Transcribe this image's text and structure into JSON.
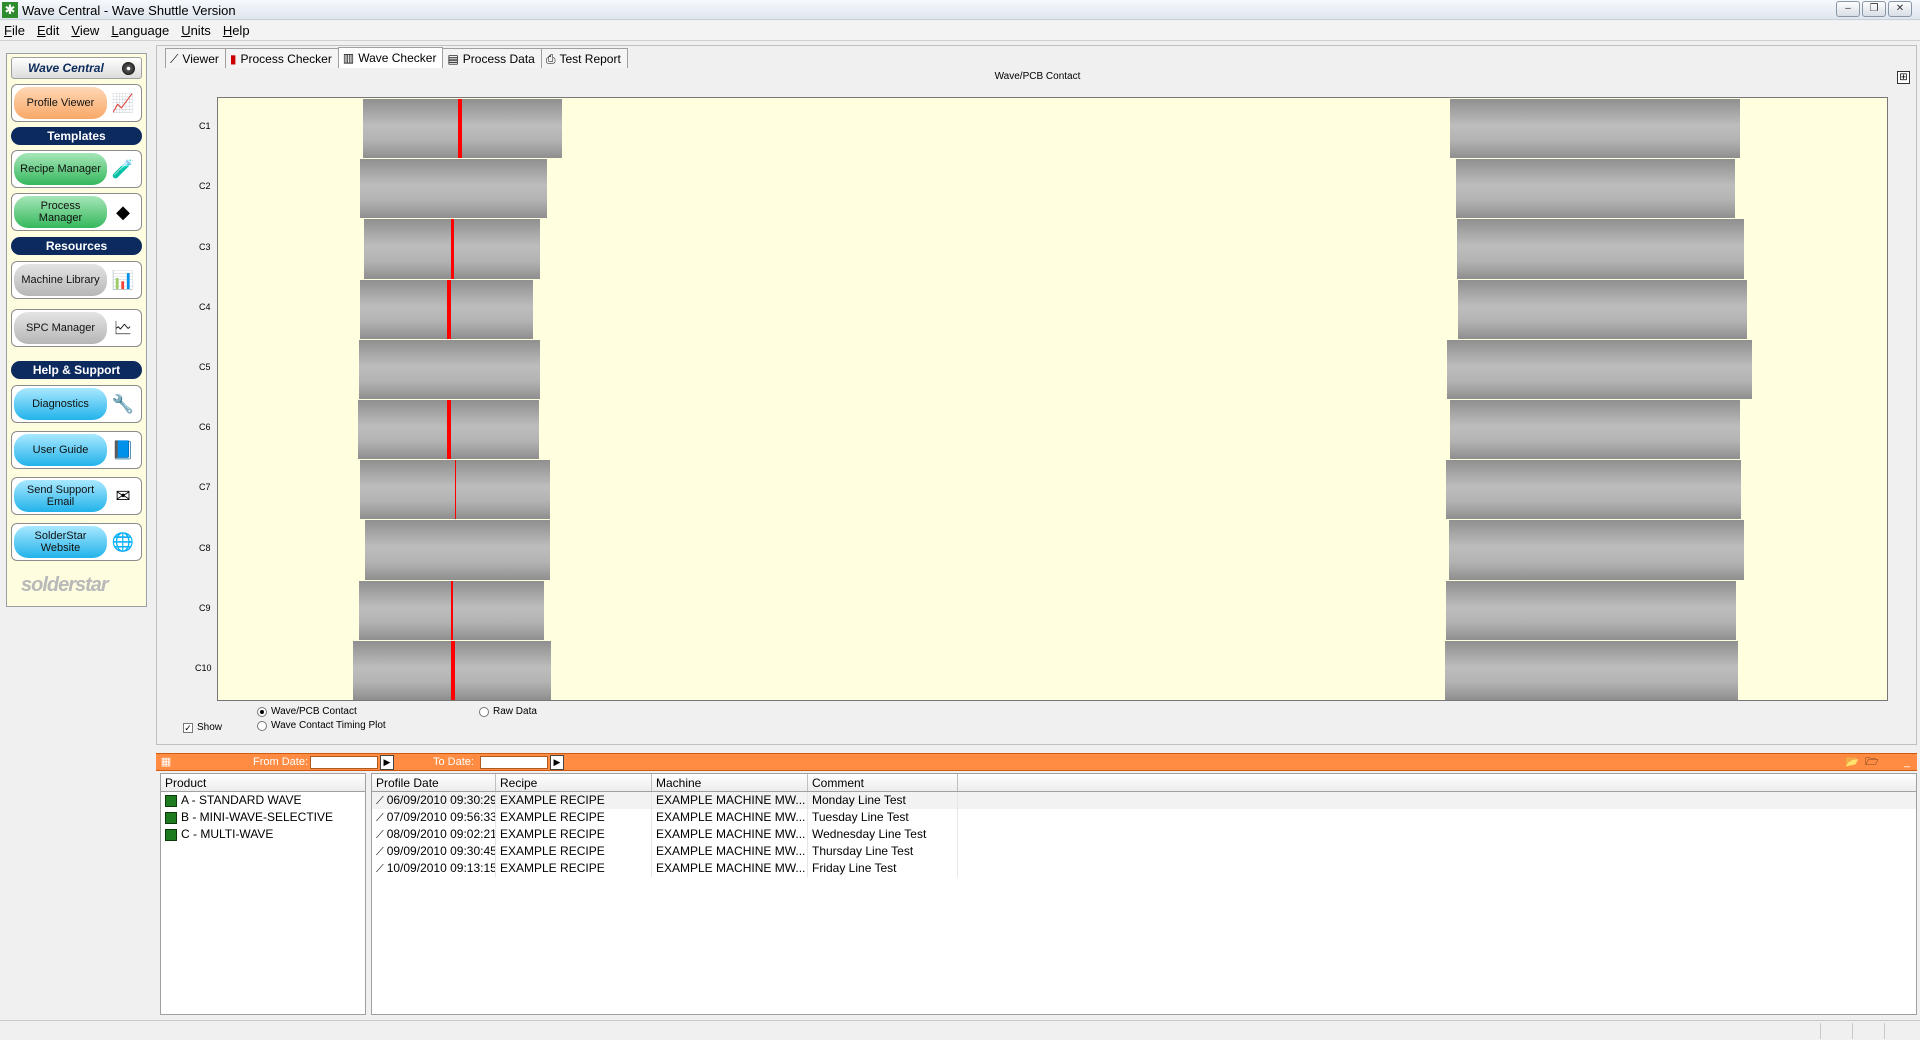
{
  "window": {
    "title": "Wave Central - Wave Shuttle Version",
    "controls": {
      "minimize": "–",
      "restore": "❐",
      "close": "✕"
    }
  },
  "menu": {
    "items": [
      {
        "ul": "F",
        "rest": "ile"
      },
      {
        "ul": "E",
        "rest": "dit"
      },
      {
        "ul": "V",
        "rest": "iew"
      },
      {
        "ul": "L",
        "rest": "anguage"
      },
      {
        "ul": "U",
        "rest": "nits"
      },
      {
        "ul": "H",
        "rest": "elp"
      }
    ]
  },
  "sidebar": {
    "header": "Wave Central",
    "buttons": {
      "profile_viewer": "Profile Viewer",
      "recipe_manager": "Recipe Manager",
      "process_manager": "Process Manager",
      "machine_library": "Machine Library",
      "spc_manager": "SPC Manager",
      "diagnostics": "Diagnostics",
      "user_guide": "User Guide",
      "send_support_email": "Send Support Email",
      "solderstar_website": "SolderStar Website"
    },
    "sections": {
      "templates": "Templates",
      "resources": "Resources",
      "help_support": "Help & Support"
    },
    "logo": "solderstar"
  },
  "tabs": {
    "viewer": "Viewer",
    "process_checker": "Process Checker",
    "wave_checker": "Wave Checker",
    "process_data": "Process Data",
    "test_report": "Test Report"
  },
  "chart": {
    "title": "Wave/PCB Contact",
    "options": {
      "wave_pcb_contact": "Wave/PCB Contact",
      "raw_data": "Raw Data",
      "timing_plot": "Wave Contact Timing Plot",
      "show": "Show"
    }
  },
  "chart_data": {
    "type": "bar",
    "title": "Wave/PCB Contact",
    "categories": [
      "C1",
      "C2",
      "C3",
      "C4",
      "C5",
      "C6",
      "C7",
      "C8",
      "C9",
      "C10"
    ],
    "series": [
      {
        "values": [
          [
            0.0866,
            0.2061
          ],
          [
            0.0851,
            0.1973
          ],
          [
            0.0873,
            0.1929
          ],
          [
            0.0851,
            0.1885
          ],
          [
            0.0844,
            0.1929
          ],
          [
            0.0836,
            0.1922
          ],
          [
            0.0851,
            0.1988
          ],
          [
            0.088,
            0.1988
          ],
          [
            0.0844,
            0.1951
          ],
          [
            0.0807,
            0.1995
          ]
        ]
      },
      {
        "values": [
          [
            0.7381,
            0.912
          ],
          [
            0.7418,
            0.9091
          ],
          [
            0.7425,
            0.9142
          ],
          [
            0.7432,
            0.9164
          ],
          [
            0.7366,
            0.9194
          ],
          [
            0.7381,
            0.912
          ],
          [
            0.7359,
            0.9127
          ],
          [
            0.7374,
            0.9142
          ],
          [
            0.7359,
            0.9098
          ],
          [
            0.7352,
            0.9105
          ]
        ]
      }
    ],
    "markers": [
      0.1451,
      null,
      0.1407,
      0.1385,
      null,
      0.1385,
      0.1422,
      null,
      0.14,
      0.1407
    ],
    "marker_widths": [
      4,
      0,
      3,
      4,
      0,
      4,
      1,
      0,
      2,
      4
    ],
    "marker_color": "#ff0000",
    "bar_color": "#b0b0b0",
    "background": "#ffffe0",
    "grid": false
  },
  "filter": {
    "from_date": "From Date:",
    "to_date": "To Date:",
    "from_value": "",
    "to_value": ""
  },
  "products": {
    "header": "Product",
    "items": [
      "A - STANDARD WAVE",
      "B - MINI-WAVE-SELECTIVE",
      "C - MULTI-WAVE"
    ]
  },
  "profiles": {
    "headers": [
      "Profile Date",
      "Recipe",
      "Machine",
      "Comment"
    ],
    "rows": [
      [
        "06/09/2010 09:30:29",
        "EXAMPLE RECIPE",
        "EXAMPLE MACHINE MW...",
        "Monday Line Test"
      ],
      [
        "07/09/2010 09:56:33",
        "EXAMPLE RECIPE",
        "EXAMPLE MACHINE MW...",
        "Tuesday Line Test"
      ],
      [
        "08/09/2010 09:02:21",
        "EXAMPLE RECIPE",
        "EXAMPLE MACHINE MW...",
        "Wednesday Line Test"
      ],
      [
        "09/09/2010 09:30:45",
        "EXAMPLE RECIPE",
        "EXAMPLE MACHINE MW...",
        "Thursday Line Test"
      ],
      [
        "10/09/2010 09:13:15",
        "EXAMPLE RECIPE",
        "EXAMPLE MACHINE MW...",
        "Friday Line Test"
      ]
    ]
  }
}
